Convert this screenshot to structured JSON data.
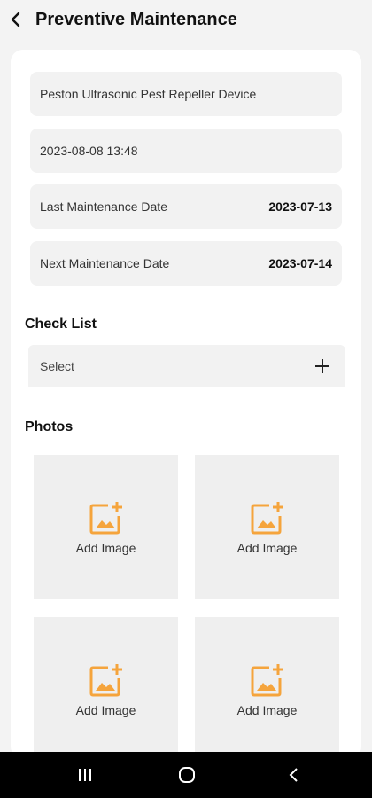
{
  "header": {
    "title": "Preventive Maintenance",
    "back_icon": "chevron-left-icon"
  },
  "device": {
    "name": "Peston Ultrasonic Pest Repeller Device"
  },
  "datetime": {
    "value": "2023-08-08 13:48"
  },
  "last_maintenance": {
    "label": "Last Maintenance Date",
    "value": "2023-07-13"
  },
  "next_maintenance": {
    "label": "Next Maintenance Date",
    "value": "2023-07-14"
  },
  "checklist": {
    "title": "Check List",
    "select_label": "Select",
    "add_icon": "plus-icon"
  },
  "photos": {
    "title": "Photos",
    "tiles": [
      {
        "label": "Add Image",
        "icon": "add-image-icon"
      },
      {
        "label": "Add Image",
        "icon": "add-image-icon"
      },
      {
        "label": "Add Image",
        "icon": "add-image-icon"
      },
      {
        "label": "Add Image",
        "icon": "add-image-icon"
      }
    ]
  },
  "colors": {
    "accent": "#f5a43c",
    "field_bg": "#f2f2f2",
    "tile_bg": "#efefef"
  },
  "system_nav": {
    "icons": [
      "recent-apps-icon",
      "home-icon",
      "back-icon"
    ]
  }
}
